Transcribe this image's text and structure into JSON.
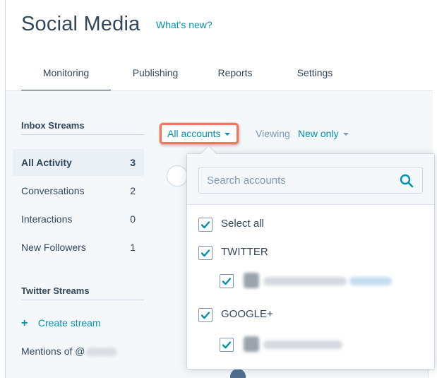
{
  "header": {
    "title": "Social Media",
    "whats_new": "What's new?"
  },
  "tabs": [
    {
      "label": "Monitoring",
      "active": true
    },
    {
      "label": "Publishing",
      "active": false
    },
    {
      "label": "Reports",
      "active": false
    },
    {
      "label": "Settings",
      "active": false
    }
  ],
  "sidebar": {
    "inbox_heading": "Inbox Streams",
    "items": [
      {
        "label": "All Activity",
        "count": "3",
        "active": true
      },
      {
        "label": "Conversations",
        "count": "2",
        "active": false
      },
      {
        "label": "Interactions",
        "count": "0",
        "active": false
      },
      {
        "label": "New Followers",
        "count": "1",
        "active": false
      }
    ],
    "twitter_heading": "Twitter Streams",
    "create_stream": "Create stream",
    "mentions": "Mentions of @"
  },
  "toolbar": {
    "accounts_label": "All accounts",
    "viewing_label": "Viewing",
    "viewing_value": "New only"
  },
  "dropdown": {
    "search_placeholder": "Search accounts",
    "select_all": "Select all",
    "groups": [
      {
        "label": "TWITTER",
        "checked": true
      },
      {
        "label": "GOOGLE+",
        "checked": true
      }
    ]
  },
  "colors": {
    "accent": "#0091ae",
    "text": "#33475b",
    "highlight_border": "#f2765b",
    "page_bg": "#f5f8fa"
  }
}
